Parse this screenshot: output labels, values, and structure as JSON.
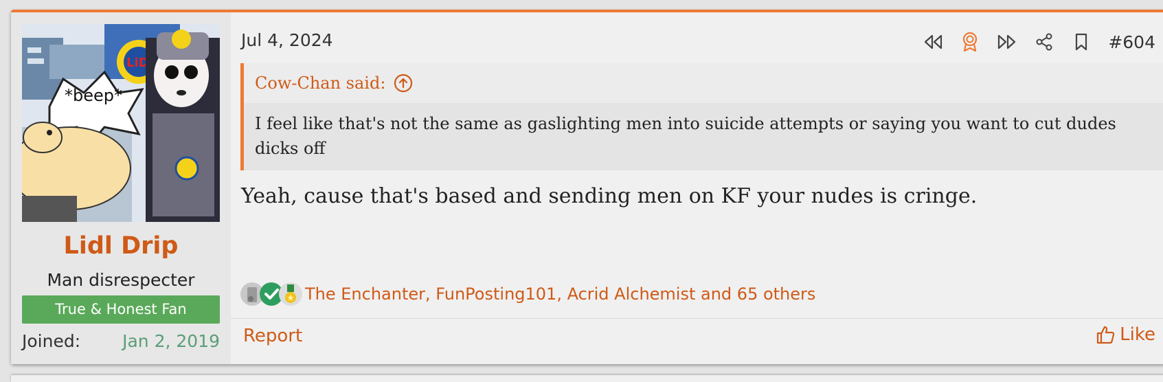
{
  "post": {
    "date": "Jul 4, 2024",
    "number": "#604",
    "user": {
      "name": "Lidl Drip",
      "title": "Man disrespecter",
      "banner": "True & Honest Fan",
      "joined_label": "Joined:",
      "joined_value": "Jan 2, 2019",
      "avatar_bubble_text": "*beep*",
      "avatar_logo_text": "LiDL"
    },
    "quote": {
      "author": "Cow-Chan said:",
      "text": "I feel like that's not the same as gaslighting men into suicide attempts or saying you want to cut dudes dicks off"
    },
    "message": "Yeah, cause that's based and sending men on KF your nudes is cringe.",
    "reactions": {
      "names": "The Enchanter, FunPosting101, Acrid Alchemist and 65 others"
    },
    "footer": {
      "report": "Report",
      "like": "Like"
    }
  },
  "icons": {
    "actions": [
      "rewind-icon",
      "award-icon",
      "fast-forward-icon",
      "share-icon",
      "bookmark-icon"
    ],
    "quote_jump": "arrow-up-circle-icon",
    "like": "thumbs-up-icon"
  },
  "colors": {
    "accent": "#ed7a33",
    "link": "#cf5a17",
    "banner": "#5aa95a",
    "joined_date": "#5b9d76"
  }
}
